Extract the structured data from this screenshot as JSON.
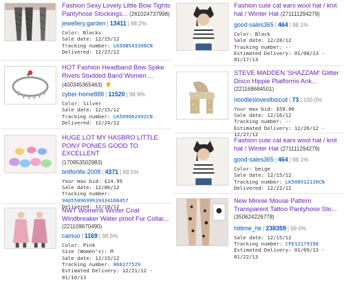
{
  "left": [
    {
      "title": "Fashion Sexy Lovely Little Bow Tights Pantyhose Stockings...",
      "item_id": "(261024737998)",
      "seller": "jewellery.garden",
      "score": "13411",
      "percent": "98.2%",
      "thumb": "tights-photo",
      "details": [
        {
          "label": "Color: ",
          "value": "Blacks"
        },
        {
          "label": "Sale date: ",
          "value": "12/15/12"
        },
        {
          "label": "Tracking number: ",
          "value": "LK508543390CN",
          "link": true
        },
        {
          "label": "Delivered: ",
          "value": "12/27/12"
        }
      ]
    },
    {
      "title": "HOT Fashion Headband Bow Spike Rivets Studded Band Women ...",
      "item_id": "(400345365463)",
      "has_badge": true,
      "seller": "cyber-home888",
      "score": "11520",
      "percent": "98.9%",
      "thumb": "necklace-photo",
      "details": [
        {
          "label": "Color: ",
          "value": "Silver"
        },
        {
          "label": "Sale date: ",
          "value": "12/15/12"
        },
        {
          "label": "Tracking number: ",
          "value": "LK509002492CN",
          "link": true
        },
        {
          "label": "Delivered: ",
          "value": "12/24/12"
        }
      ]
    },
    {
      "title": "HUGE LOT MY HASBRO LITTLE PONY PONIES GOOD TO EXCELLENT",
      "item_id": "(170953502983)",
      "seller": "britforlife-2008",
      "score": "4371",
      "percent": "99.5%",
      "thumb": "ponies-photo",
      "details": [
        {
          "label": "Your max bid: ",
          "value": "$14.99"
        },
        {
          "label": "Sale date: ",
          "value": "12/06/12"
        },
        {
          "label": "Tracking number: ",
          "value": ""
        },
        {
          "label": "",
          "value": "9405509699939334106457",
          "link": true
        },
        {
          "label": "Delivered: ",
          "value": "12/10/12"
        }
      ]
    },
    {
      "title": "NWT Womens Winter Coat Windbreaker Water proof Fur Collar...",
      "item_id": "(221109670490)",
      "seller": "camuo",
      "score": "1169",
      "percent": "98.5%",
      "thumb": "coat-photo",
      "details": [
        {
          "label": "Color: ",
          "value": "Pink"
        },
        {
          "label": "Size (Women's): ",
          "value": "M"
        },
        {
          "label": "Sale date: ",
          "value": "12/15/12"
        },
        {
          "label": "Tracking number: ",
          "value": "860177529",
          "link": true
        },
        {
          "label": "Estimated Delivery: ",
          "value": "12/21/12 -"
        },
        {
          "label": "",
          "value": "01/10/13"
        }
      ]
    }
  ],
  "right": [
    {
      "title": "Fashion cute cat ears wool hat / knit hat / Winter Hat",
      "item_id": "(271111294279)",
      "seller": "good-sales365",
      "score": "464",
      "percent": "98.1%",
      "thumb": "cat-hat-photo",
      "details": [
        {
          "label": "Color: ",
          "value": "Black"
        },
        {
          "label": "Sale date: ",
          "value": "12/28/12"
        },
        {
          "label": "Tracking number: ",
          "value": "--"
        },
        {
          "label": "Estimated Delivery: ",
          "value": "01/08/13 -"
        },
        {
          "label": "",
          "value": "01/17/13"
        }
      ]
    },
    {
      "title": "STEVE MADDEN 'SHAZZAM' Glitter Disco Hippie Platforms Ank...",
      "item_id": "(221168684501)",
      "seller": "noodlesloveslbiscuit",
      "score": "73",
      "percent": "100.0%",
      "thumb": "platform-shoe-photo",
      "details": [
        {
          "label": "Your max bid: ",
          "value": "$59.00"
        },
        {
          "label": "Sale date: ",
          "value": "12/16/12"
        },
        {
          "label": "Tracking number: ",
          "value": "--"
        },
        {
          "label": "Estimated Delivery: ",
          "value": "12/26/12 -"
        },
        {
          "label": "",
          "value": "12/27/12"
        }
      ]
    },
    {
      "title": "Fashion cute cat ears wool hat / knit hat / Winter Hat",
      "item_id": "(271111294279)",
      "seller": "good-sales365",
      "score": "464",
      "percent": "98.1%",
      "thumb": "cat-hat-photo",
      "details": [
        {
          "label": "Color: ",
          "value": "beige"
        },
        {
          "label": "Sale date: ",
          "value": "12/15/12"
        },
        {
          "label": "Tracking number: ",
          "value": "LK508912130CN",
          "link": true
        },
        {
          "label": "Delivered: ",
          "value": "12/22/12"
        }
      ]
    },
    {
      "title": "New Minnie Mouse Pattern Transparent Tattoo Pantyhose Sto...",
      "item_id": "(350624226778)",
      "seller": "hittime_hk",
      "score": "238359",
      "percent": "99.0%",
      "thumb": "tattoo-tights-photo",
      "details": [
        {
          "label": "Sale date: ",
          "value": "12/15/12"
        },
        {
          "label": "Tracking number: ",
          "value": "CFE12179198",
          "link": true
        },
        {
          "label": "Estimated Delivery: ",
          "value": "01/09/13 -"
        },
        {
          "label": "",
          "value": "01/22/13"
        }
      ]
    }
  ]
}
